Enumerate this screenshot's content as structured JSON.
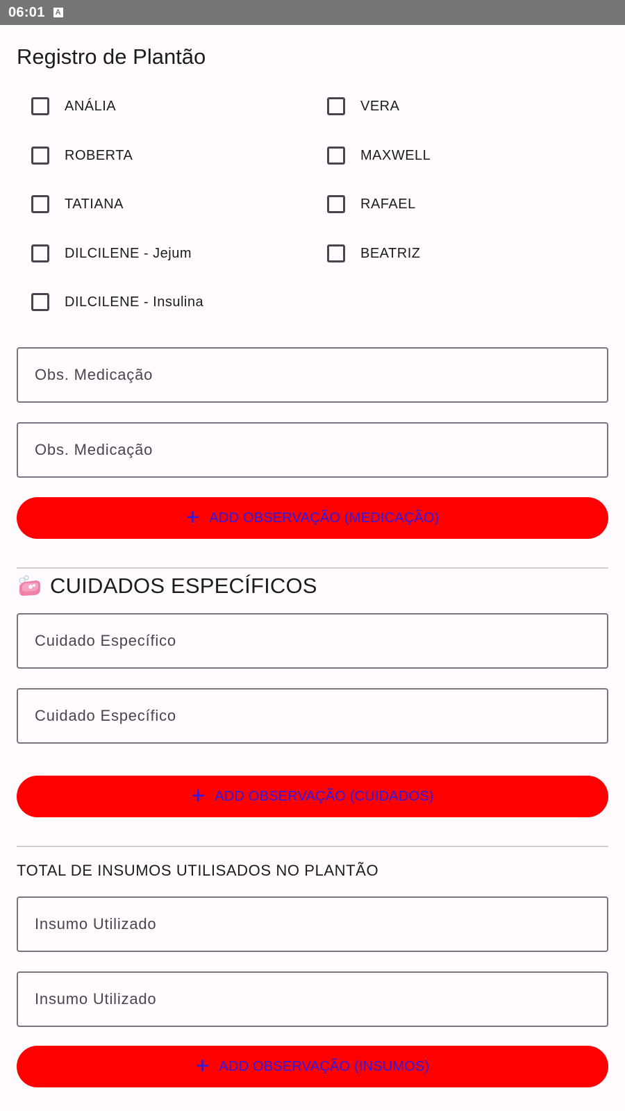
{
  "status_bar": {
    "time": "06:01",
    "notification_icon": "A"
  },
  "page_title": "Registro de Plantão",
  "checkboxes_left": [
    {
      "label": "ANÁLIA",
      "checked": false
    },
    {
      "label": "ROBERTA",
      "checked": false
    },
    {
      "label": "TATIANA",
      "checked": false
    },
    {
      "label": "DILCILENE - Jejum",
      "checked": false
    },
    {
      "label": "DILCILENE - Insulina",
      "checked": false
    }
  ],
  "checkboxes_right": [
    {
      "label": "VERA",
      "checked": false
    },
    {
      "label": "MAXWELL",
      "checked": false
    },
    {
      "label": "RAFAEL",
      "checked": false
    },
    {
      "label": "BEATRIZ",
      "checked": false
    }
  ],
  "medicacao": {
    "fields": [
      {
        "placeholder": "Obs. Medicação",
        "value": ""
      },
      {
        "placeholder": "Obs. Medicação",
        "value": ""
      }
    ],
    "add_button": "ADD OBSERVAÇÃO (MEDICAÇÃO)"
  },
  "cuidados": {
    "section_icon": "soap-icon",
    "section_title": "CUIDADOS ESPECÍFICOS",
    "fields": [
      {
        "placeholder": "Cuidado Específico",
        "value": ""
      },
      {
        "placeholder": "Cuidado Específico",
        "value": ""
      }
    ],
    "add_button": "ADD OBSERVAÇÃO (CUIDADOS)"
  },
  "insumos": {
    "section_title": "TOTAL DE INSUMOS UTILISADOS NO PLANTÃO",
    "fields": [
      {
        "placeholder": "Insumo Utilizado",
        "value": ""
      },
      {
        "placeholder": "Insumo Utilizado",
        "value": ""
      }
    ],
    "add_button": "ADD OBSERVAÇÃO (INSUMOS)"
  },
  "colors": {
    "button_bg": "#ff0000",
    "button_text": "#2b1be8",
    "status_bar": "#757575",
    "background": "#fffbfe"
  }
}
